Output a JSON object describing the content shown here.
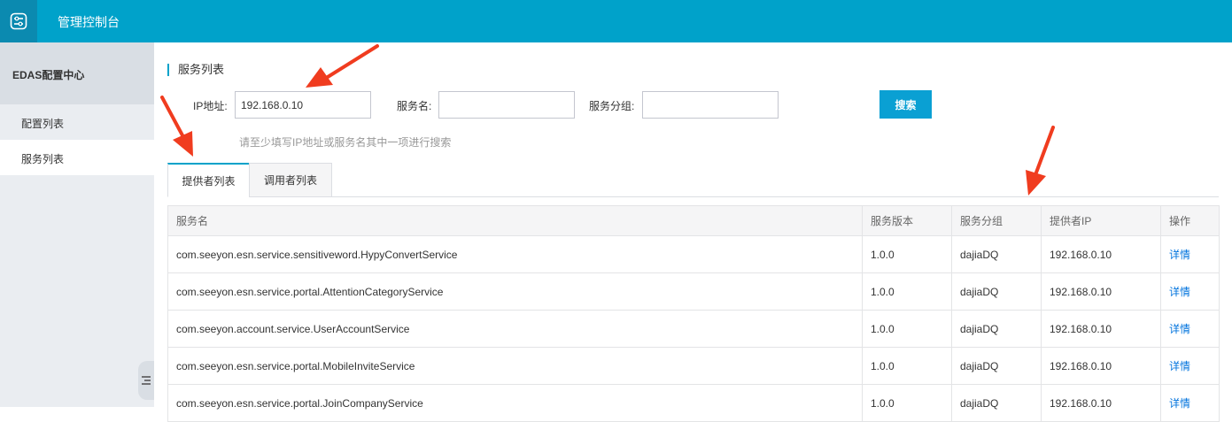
{
  "header": {
    "title": "管理控制台",
    "logo_icon": "console-logo-icon"
  },
  "sidebar": {
    "title": "EDAS配置中心",
    "items": [
      {
        "label": "配置列表",
        "active": false
      },
      {
        "label": "服务列表",
        "active": true
      }
    ],
    "collapse_icon": "collapse-menu-icon"
  },
  "main": {
    "title": "服务列表",
    "form": {
      "ip_label": "IP地址:",
      "ip_value": "192.168.0.10",
      "service_name_label": "服务名:",
      "service_name_value": "",
      "group_label": "服务分组:",
      "group_value": "",
      "search_label": "搜索",
      "hint": "请至少填写IP地址或服务名其中一项进行搜索"
    },
    "tabs": [
      {
        "label": "提供者列表",
        "active": true
      },
      {
        "label": "调用者列表",
        "active": false
      }
    ],
    "table": {
      "columns": [
        "服务名",
        "服务版本",
        "服务分组",
        "提供者IP",
        "操作"
      ],
      "rows": [
        {
          "name": "com.seeyon.esn.service.sensitiveword.HypyConvertService",
          "version": "1.0.0",
          "group": "dajiaDQ",
          "ip": "192.168.0.10",
          "action": "详情"
        },
        {
          "name": "com.seeyon.esn.service.portal.AttentionCategoryService",
          "version": "1.0.0",
          "group": "dajiaDQ",
          "ip": "192.168.0.10",
          "action": "详情"
        },
        {
          "name": "com.seeyon.account.service.UserAccountService",
          "version": "1.0.0",
          "group": "dajiaDQ",
          "ip": "192.168.0.10",
          "action": "详情"
        },
        {
          "name": "com.seeyon.esn.service.portal.MobileInviteService",
          "version": "1.0.0",
          "group": "dajiaDQ",
          "ip": "192.168.0.10",
          "action": "详情"
        },
        {
          "name": "com.seeyon.esn.service.portal.JoinCompanyService",
          "version": "1.0.0",
          "group": "dajiaDQ",
          "ip": "192.168.0.10",
          "action": "详情"
        }
      ]
    }
  },
  "colors": {
    "header_bg": "#00a2ca",
    "accent": "#0aa0d3",
    "link": "#0073dd",
    "annotation_arrow": "#f03c1f"
  }
}
